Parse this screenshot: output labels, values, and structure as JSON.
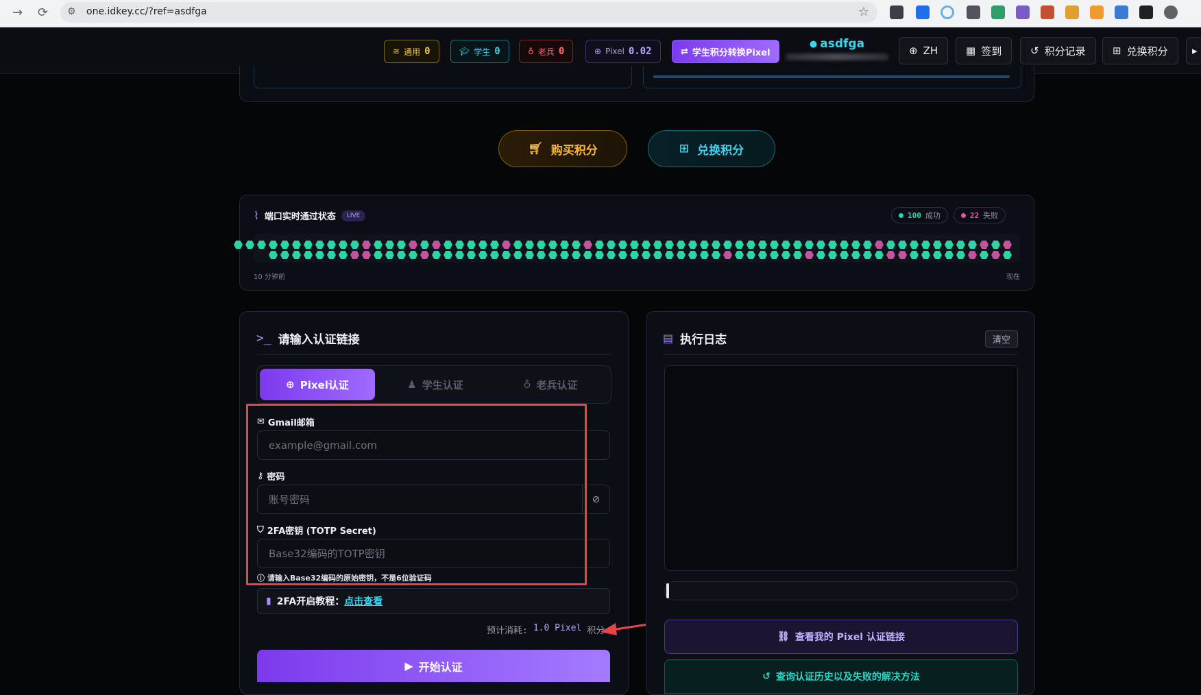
{
  "browser": {
    "url": "one.idkey.cc/?ref=asdfga"
  },
  "header": {
    "credits": [
      {
        "label": "通用",
        "value": "0"
      },
      {
        "label": "学生",
        "value": "0"
      },
      {
        "label": "老兵",
        "value": "0"
      },
      {
        "label": "Pixel",
        "value": "0.02"
      }
    ],
    "convert_label": "学生积分转换Pixel",
    "username": "asdfga",
    "lang_label": "ZH",
    "checkin_label": "签到",
    "history_label": "积分记录",
    "redeem_label": "兑换积分"
  },
  "actions": {
    "buy_label": "购买积分",
    "redeem_label": "兑换积分"
  },
  "status": {
    "title": "端口实时通过状态",
    "live": "LIVE",
    "success_count": "100",
    "success_label": "成功",
    "fail_count": "22",
    "fail_label": "失败",
    "start_label": "10 分钟前",
    "end_label": "现在",
    "row1": "gggggggggggpgggpgpgggggpggggggpggggggggggggggggggggggggpggggggggpgp",
    "row2": "gggggggppggggpgggggggggggggggggggggggggpggggggpggggggppgggggpgpg",
    "success_color": "#2dd4a7",
    "fail_color": "#c5529e"
  },
  "form": {
    "title": "请输入认证链接",
    "tabs": [
      "Pixel认证",
      "学生认证",
      "老兵认证"
    ],
    "email_label": "Gmail邮箱",
    "email_placeholder": "example@gmail.com",
    "password_label": "密码",
    "password_placeholder": "账号密码",
    "totp_label": "2FA密钥 (TOTP Secret)",
    "totp_placeholder": "Base32编码的TOTP密钥",
    "totp_hint": "请输入Base32编码的原始密钥，不是6位验证码",
    "tutorial_label": "2FA开启教程：",
    "tutorial_link": "点击查看",
    "cost_label": "预计消耗:",
    "cost_value": "1.0 Pixel",
    "cost_unit": "积分",
    "start_label": "开始认证"
  },
  "log": {
    "title": "执行日志",
    "clear_label": "清空",
    "view_links_label": "查看我的 Pixel 认证链接",
    "history_label": "查询认证历史以及失败的解决方法"
  }
}
